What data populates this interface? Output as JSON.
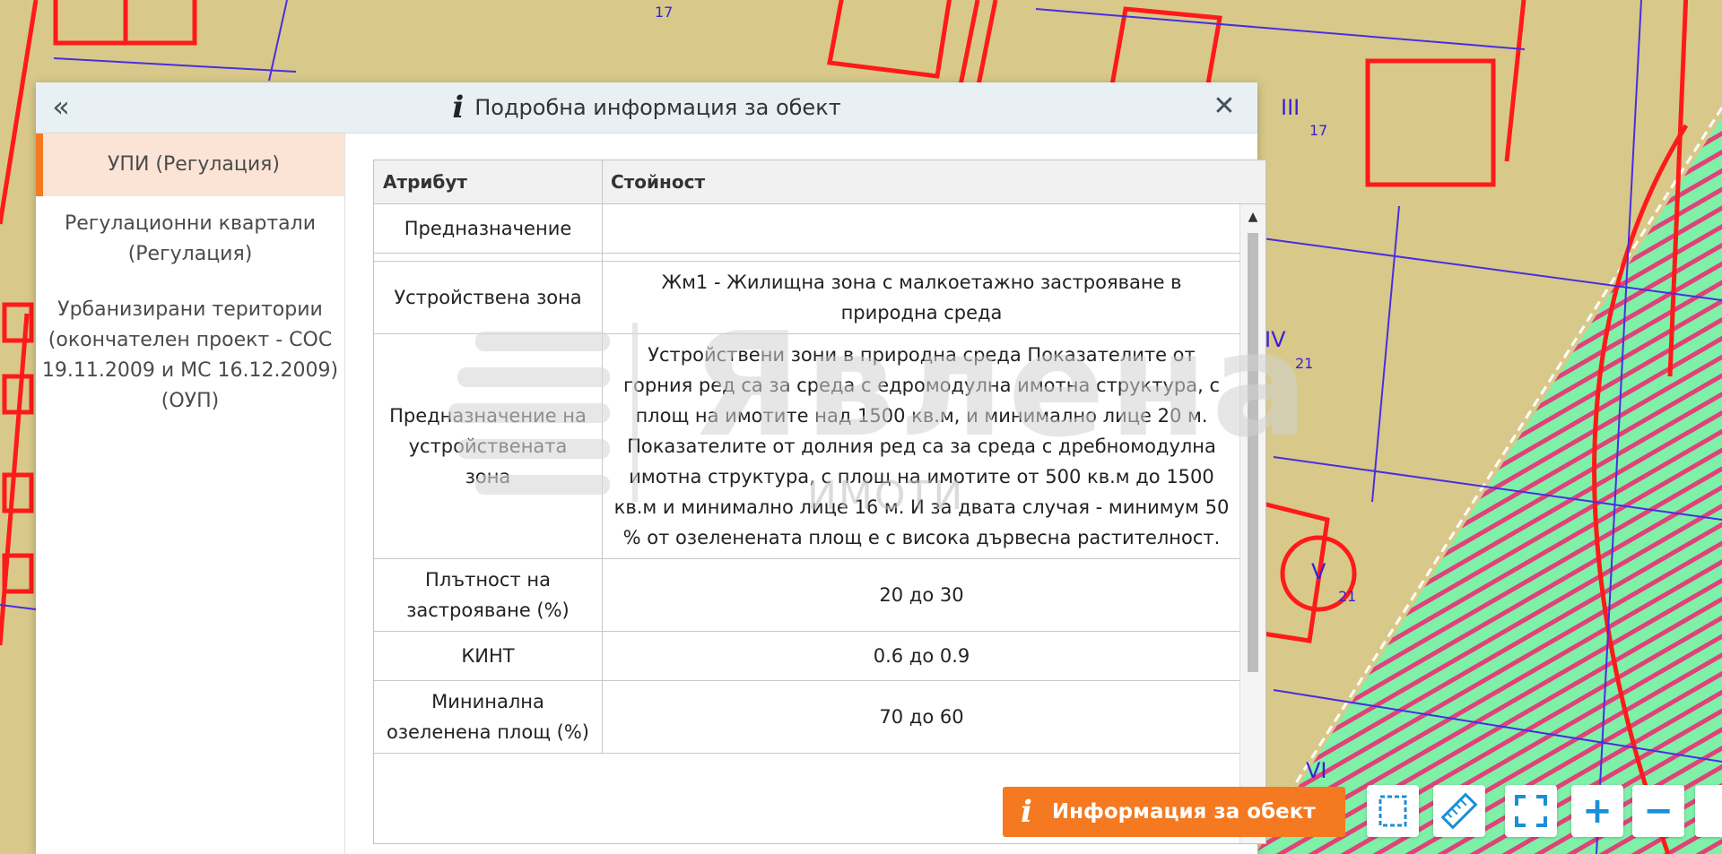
{
  "map": {
    "labels": {
      "lot_17_top": "17",
      "roman_iii": "III",
      "sub_17": "17",
      "roman_iv": "IV",
      "sub_21_a": "21",
      "roman_v": "V",
      "sub_21_b": "21",
      "roman_vi": "VI"
    }
  },
  "dialog": {
    "title": "Подробна информация за обект",
    "collapse_icon": "«",
    "close_icon": "✕",
    "info_icon": "i"
  },
  "sidebar": {
    "items": [
      {
        "label": "УПИ (Регулация)",
        "active": true
      },
      {
        "label": "Регулационни квартали (Регулация)",
        "active": false
      },
      {
        "label": "Урбанизирани територии (окончателен проект - СОС 19.11.2009 и МС 16.12.2009) (ОУП)",
        "active": false
      }
    ]
  },
  "table": {
    "headers": {
      "attribute": "Атрибут",
      "value": "Стойност"
    },
    "rows": [
      {
        "attribute": "Предназначение",
        "value": ""
      },
      {
        "attribute": "",
        "value": ""
      },
      {
        "attribute": "Устройствена зона",
        "value": "Жм1 - Жилищна зона с малкоетажно застрояване в природна среда"
      },
      {
        "attribute": "Предназначение на устройствената зона",
        "value": "Устройствени зони в природна среда Показателите от горния ред са за среда с едромодулна имотна структура, с площ на имотите над 1500 кв.м, и минимално лице 20 м. Показателите от долния ред са за среда с дребномодулна имотна структура, с площ на имотите от 500 кв.м до 1500 кв.м и минимално лице 16 м. И за двата случая - минимум 50 % от озеленената площ е с висока дървесна растителност."
      },
      {
        "attribute": "Плътност на застрояване (%)",
        "value": "20 до 30"
      },
      {
        "attribute": "КИНТ",
        "value": "0.6 до 0.9"
      },
      {
        "attribute": "Мининална озеленена площ (%)",
        "value": "70 до 60"
      }
    ]
  },
  "watermark": {
    "main": "Явлена",
    "sub": "ИМОТИ"
  },
  "toolbar": {
    "info_button_label": "Информация за обект",
    "info_button_icon": "i",
    "tools": [
      {
        "name": "select-area-icon",
        "glyph": "⬚"
      },
      {
        "name": "ruler-icon",
        "glyph": "📏"
      },
      {
        "name": "fullscreen-icon",
        "glyph": "⛶"
      },
      {
        "name": "zoom-in-icon",
        "glyph": "+"
      },
      {
        "name": "zoom-out-icon",
        "glyph": "−"
      }
    ]
  },
  "colors": {
    "accent": "#f47920",
    "parcel_line": "#ff1a1a",
    "map_base": "#d8c98a",
    "green_zone": "#7ef0a8",
    "hatch": "#e0427a",
    "label": "#3a1fd6"
  }
}
